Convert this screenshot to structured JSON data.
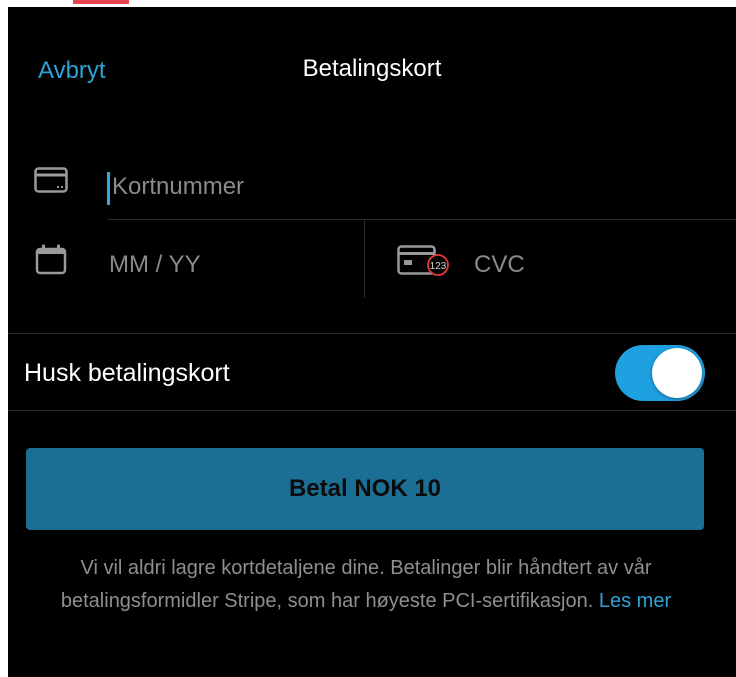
{
  "nav": {
    "cancel_label": "Avbryt",
    "title": "Betalingskort"
  },
  "form": {
    "card_number": {
      "placeholder": "Kortnummer",
      "value": ""
    },
    "expiry": {
      "placeholder": "MM / YY",
      "value": ""
    },
    "cvc": {
      "placeholder": "CVC",
      "value": "",
      "icon_text": "123"
    }
  },
  "remember": {
    "label": "Husk betalingskort",
    "enabled": true
  },
  "pay_button": {
    "label": "Betal NOK 10"
  },
  "info": {
    "text": "Vi vil aldri lagre kortdetaljene dine. Betalinger blir håndtert av vår betalingsformidler Stripe, som har høyeste PCI-sertifikasjon.",
    "link_label": "Les mer"
  },
  "icons": {
    "card": "credit-card-icon",
    "calendar": "calendar-icon",
    "cvc": "card-cvc-icon"
  },
  "colors": {
    "background": "#000000",
    "accent": "#2fa3d6",
    "toggle_on": "#1fa0e0",
    "button": "#1b6f94",
    "muted_text": "#8e8e93",
    "divider": "#2c2c2e"
  }
}
